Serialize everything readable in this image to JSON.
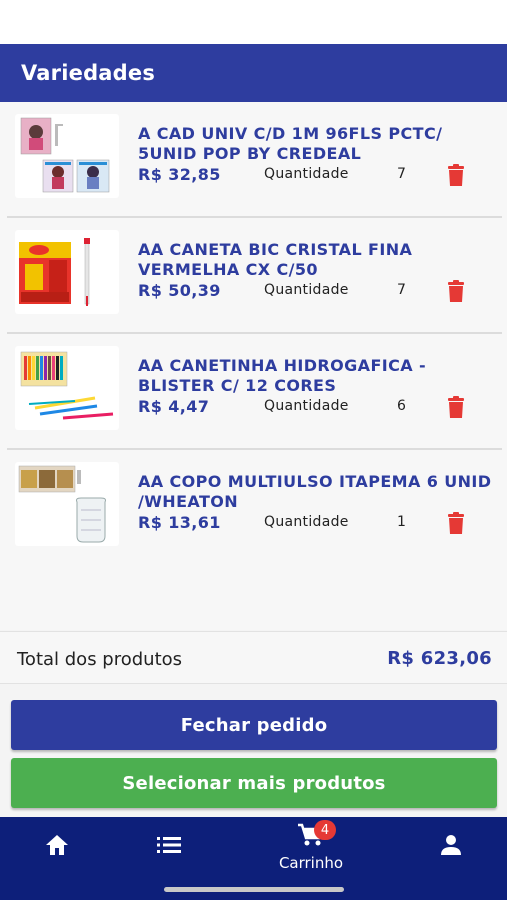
{
  "header": {
    "title": "Variedades"
  },
  "items": [
    {
      "name": "A CAD UNIV C/D 1M 96FLS PCTC/ 5UNID POP BY CREDEAL",
      "price": "R$ 32,85",
      "qty_label": "Quantidade",
      "qty": "7",
      "thumb": "notebooks-image"
    },
    {
      "name": "AA CANETA BIC CRISTAL FINA VERMELHA CX C/50",
      "price": "R$ 50,39",
      "qty_label": "Quantidade",
      "qty": "7",
      "thumb": "pen-box-image"
    },
    {
      "name": "AA CANETINHA HIDROGAFICA - BLISTER C/ 12 CORES",
      "price": "R$ 4,47",
      "qty_label": "Quantidade",
      "qty": "6",
      "thumb": "markers-image"
    },
    {
      "name": "AA COPO MULTIULSO ITAPEMA 6 UNID /WHEATON",
      "price": "R$ 13,61",
      "qty_label": "Quantidade",
      "qty": "1",
      "thumb": "glass-jar-image"
    }
  ],
  "total": {
    "label": "Total dos produtos",
    "value": "R$ 623,06"
  },
  "buttons": {
    "primary": "Fechar pedido",
    "secondary": "Selecionar mais produtos"
  },
  "tabbar": {
    "cart_label": "Carrinho",
    "cart_badge": "4",
    "icons": [
      "home-icon",
      "list-icon",
      "cart-icon",
      "user-icon"
    ]
  },
  "colors": {
    "brand": "#2e3d9f",
    "nav": "#0d1f7a",
    "success": "#4caf50",
    "danger": "#e53935"
  }
}
